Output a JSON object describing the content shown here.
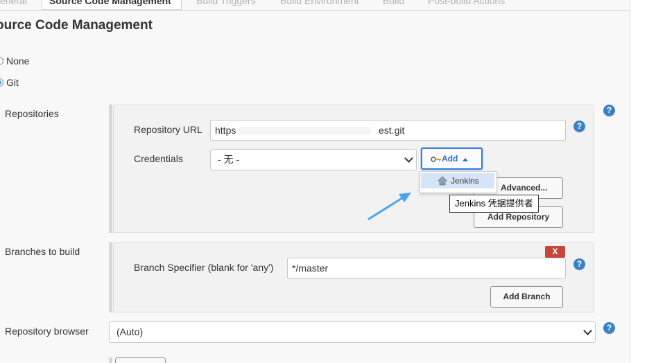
{
  "tabs": [
    {
      "label": "eneral"
    },
    {
      "label": "Source Code Management"
    },
    {
      "label": "Build Triggers"
    },
    {
      "label": "Build Environment"
    },
    {
      "label": "Build"
    },
    {
      "label": "Post-build Actions"
    }
  ],
  "section_title": "ource Code Management",
  "scm_options": [
    {
      "label": "None",
      "checked": false
    },
    {
      "label": "Git",
      "checked": true
    }
  ],
  "repositories": {
    "label": "Repositories",
    "url_label": "Repository URL",
    "url_prefix": "https",
    "url_suffix": "est.git",
    "credentials_label": "Credentials",
    "credentials_selected": "- 无 -",
    "add_button": "Add",
    "advanced_button": "Advanced...",
    "add_repository_button": "Add Repository"
  },
  "add_menu": {
    "items": [
      {
        "label": "Jenkins"
      }
    ],
    "tooltip": "Jenkins 凭据提供者"
  },
  "branches": {
    "label": "Branches to build",
    "remove_button": "X",
    "specifier_label": "Branch Specifier (blank for 'any')",
    "specifier_value": "*/master",
    "add_branch_button": "Add Branch"
  },
  "repo_browser": {
    "label": "Repository browser",
    "selected": "(Auto)"
  },
  "help_icon_text": "?",
  "colors": {
    "accent": "#3b82c4",
    "focus": "#3b7dd8",
    "danger": "#c7453a",
    "panel_bg": "#f8f8f8",
    "box_bg": "#f2f2f2",
    "arrow": "#4aa3ee"
  },
  "icons": {
    "key": "key-icon",
    "house": "house-icon",
    "help": "help-icon",
    "caret": "caret-up-icon",
    "chevron": "chevron-down-icon",
    "arrow": "annotation-arrow-icon"
  }
}
